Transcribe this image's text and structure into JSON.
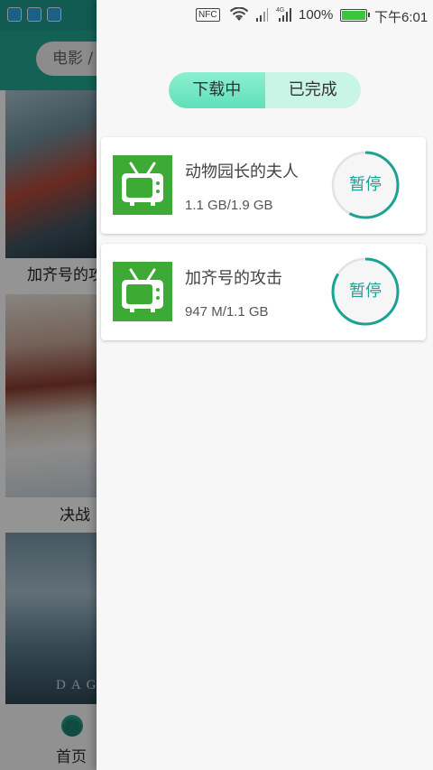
{
  "background_app": {
    "search_placeholder": "电影 / ...",
    "movies": [
      {
        "title": "加齐号的攻击"
      },
      {
        "title": "决战"
      },
      {
        "title": ""
      }
    ],
    "poster3_text": "DAG",
    "nav": {
      "home_label": "首页"
    }
  },
  "status_bar": {
    "nfc": "NFC",
    "network": "4G",
    "battery": "100%",
    "time": "下午6:01"
  },
  "drawer": {
    "tabs": [
      {
        "label": "下载中",
        "active": true
      },
      {
        "label": "已完成",
        "active": false
      }
    ],
    "downloads": [
      {
        "title": "动物园长的夫人",
        "size": "1.1 GB/1.9 GB",
        "progress": 0.58,
        "action": "暂停"
      },
      {
        "title": "加齐号的攻击",
        "size": "947 M/1.1 GB",
        "progress": 0.84,
        "action": "暂停"
      }
    ]
  },
  "colors": {
    "accent": "#1aa394",
    "tab_active": "#5fe0b8",
    "tab_inactive": "#c8f5e6",
    "tv_icon_green": "#3daa36"
  }
}
